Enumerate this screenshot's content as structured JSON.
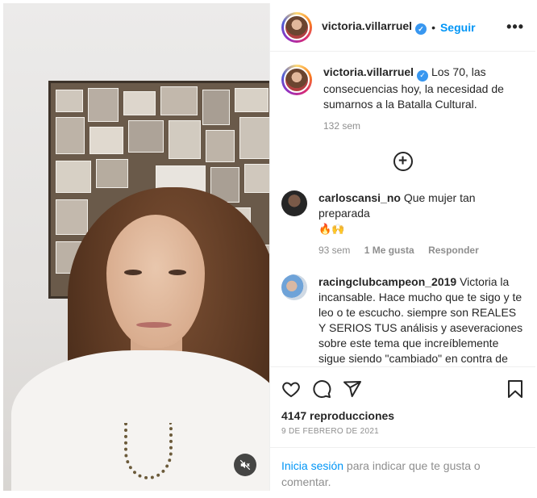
{
  "post": {
    "username": "victoria.villarruel",
    "follow_label": "Seguir",
    "more_label": "•••",
    "caption": "Los 70, las consecuencias hoy, la necesidad de sumarnos a la Batalla Cultural.",
    "caption_time": "132 sem"
  },
  "comments": [
    {
      "username": "carloscansi_no",
      "text": "Que mujer tan preparada",
      "emoji": "🔥🙌",
      "time": "93 sem",
      "likes": "1 Me gusta",
      "reply_label": "Responder"
    },
    {
      "username": "racingclubcampeon_2019",
      "text": "Victoria la incansable. Hace mucho que te sigo y te leo o te escucho. siempre son REALES Y SERIOS TUS análisis y aseveraciones sobre este tema que increíblemente sigue siendo \"cambiado\" en contra de algunos y \"a favor\" de otros, cuando las"
    }
  ],
  "stats": {
    "views": "4147 reproducciones",
    "date": "9 DE FEBRERO DE 2021"
  },
  "footer": {
    "login_link": "Inicia sesión",
    "login_rest": " para indicar que te gusta o comentar."
  },
  "icons": {
    "heart": "heart-icon",
    "comment": "comment-icon",
    "share": "share-icon",
    "save": "bookmark-icon",
    "mute": "muted-speaker-icon",
    "load_more": "plus-circle-icon"
  },
  "colors": {
    "link": "#0095f6",
    "text": "#262626",
    "muted": "#8e8e8e",
    "verified": "#3897f0"
  }
}
